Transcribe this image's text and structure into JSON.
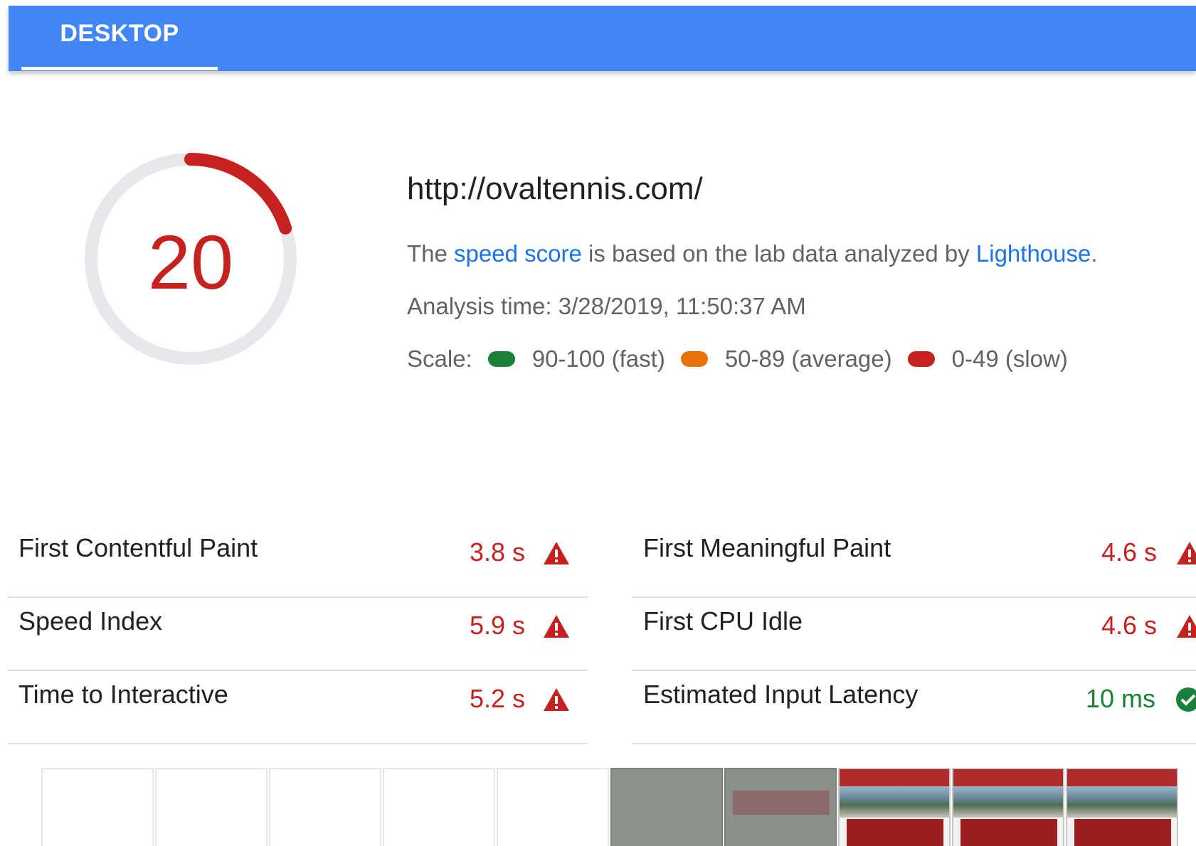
{
  "tabs": [
    {
      "label": "DESKTOP",
      "active": true
    }
  ],
  "score": {
    "value": "20",
    "fraction": 0.2,
    "color": "#c5221f",
    "track_color": "#e8e8ec"
  },
  "summary": {
    "url": "http://ovaltennis.com/",
    "desc_prefix": "The ",
    "desc_link1": "speed score",
    "desc_middle": " is based on the lab data analyzed by ",
    "desc_link2": "Lighthouse",
    "desc_suffix": ".",
    "analysis_time": "Analysis time: 3/28/2019, 11:50:37 AM",
    "scale_label": "Scale:",
    "scale": [
      {
        "label": "90-100 (fast)",
        "color": "#188038"
      },
      {
        "label": "50-89 (average)",
        "color": "#e8710a"
      },
      {
        "label": "0-49 (slow)",
        "color": "#c5221f"
      }
    ]
  },
  "metrics_left": [
    {
      "label": "First Contentful Paint",
      "value": "3.8 s",
      "status": "slow"
    },
    {
      "label": "Speed Index",
      "value": "5.9 s",
      "status": "slow"
    },
    {
      "label": "Time to Interactive",
      "value": "5.2 s",
      "status": "slow"
    }
  ],
  "metrics_right": [
    {
      "label": "First Meaningful Paint",
      "value": "4.6 s",
      "status": "slow"
    },
    {
      "label": "First CPU Idle",
      "value": "4.6 s",
      "status": "slow"
    },
    {
      "label": "Estimated Input Latency",
      "value": "10 ms",
      "status": "fast"
    }
  ],
  "colors": {
    "slow": "#c5221f",
    "fast": "#188038",
    "tabbar": "#4285f4"
  },
  "icons": {
    "slow": "warning-triangle-icon",
    "fast": "check-circle-icon"
  }
}
